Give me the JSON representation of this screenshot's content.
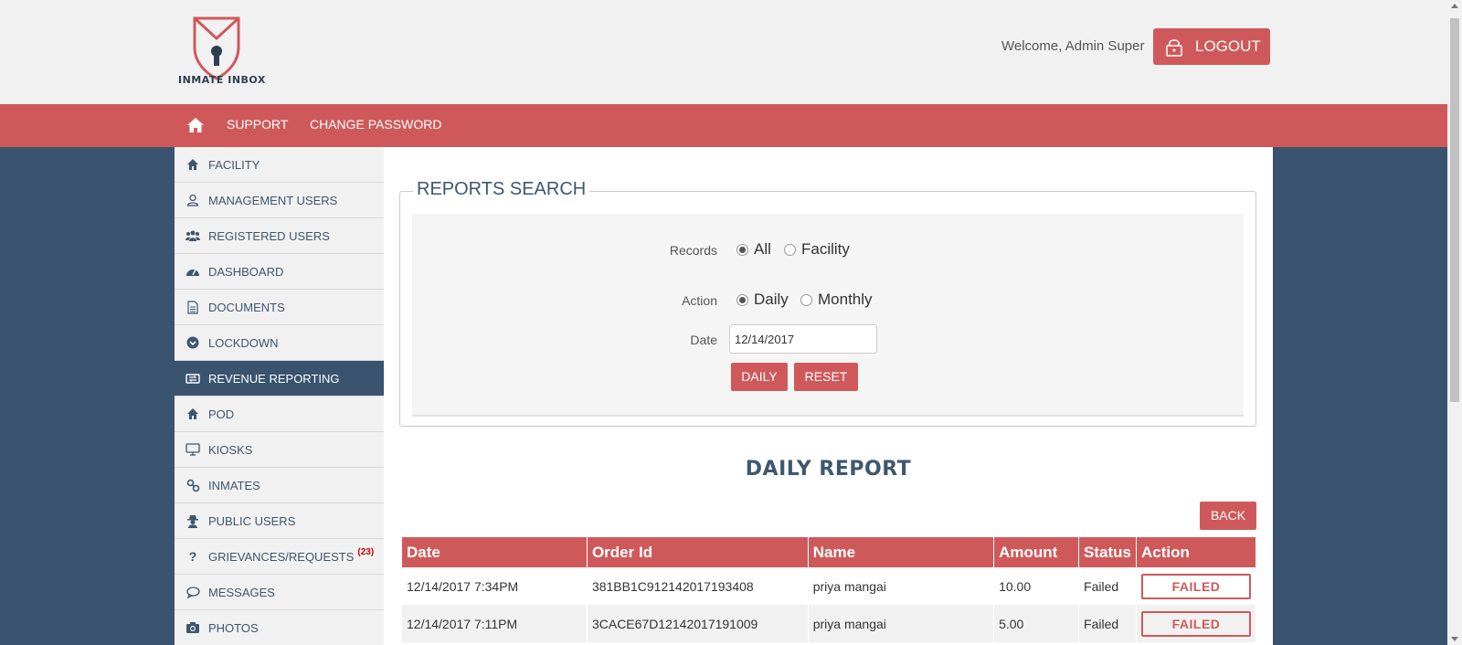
{
  "header": {
    "logo_text": "INMATE INBOX",
    "welcome": "Welcome, Admin Super",
    "logout_label": "LOGOUT"
  },
  "nav": {
    "links": [
      "SUPPORT",
      "CHANGE PASSWORD"
    ]
  },
  "sidebar": {
    "items": [
      {
        "label": "FACILITY",
        "icon": "home-icon"
      },
      {
        "label": "MANAGEMENT USERS",
        "icon": "user-icon"
      },
      {
        "label": "REGISTERED USERS",
        "icon": "users-icon"
      },
      {
        "label": "DASHBOARD",
        "icon": "dashboard-icon"
      },
      {
        "label": "DOCUMENTS",
        "icon": "document-icon"
      },
      {
        "label": "LOCKDOWN",
        "icon": "chevron-circle-icon"
      },
      {
        "label": "REVENUE REPORTING",
        "icon": "exchange-icon",
        "active": true
      },
      {
        "label": "POD",
        "icon": "home-icon"
      },
      {
        "label": "KIOSKS",
        "icon": "monitor-icon"
      },
      {
        "label": "INMATES",
        "icon": "link-icon"
      },
      {
        "label": "PUBLIC USERS",
        "icon": "user-secret-icon"
      },
      {
        "label": "GRIEVANCES/REQUESTS",
        "icon": "question-icon",
        "badge": "(23)"
      },
      {
        "label": "MESSAGES",
        "icon": "chat-icon"
      },
      {
        "label": "PHOTOS",
        "icon": "camera-icon"
      }
    ]
  },
  "search": {
    "legend": "REPORTS SEARCH",
    "records_label": "Records",
    "records_options": [
      "All",
      "Facility"
    ],
    "records_selected": "All",
    "action_label": "Action",
    "action_options": [
      "Daily",
      "Monthly"
    ],
    "action_selected": "Daily",
    "date_label": "Date",
    "date_value": "12/14/2017",
    "daily_button": "DAILY",
    "reset_button": "RESET"
  },
  "report": {
    "title": "DAILY REPORT",
    "back_button": "BACK",
    "columns": [
      "Date",
      "Order Id",
      "Name",
      "Amount",
      "Status",
      "Action"
    ],
    "rows": [
      {
        "date": "12/14/2017 7:34PM",
        "order_id": "381BB1C912142017193408",
        "name": "priya mangai",
        "amount": "10.00",
        "status": "Failed",
        "action": "FAILED"
      },
      {
        "date": "12/14/2017 7:11PM",
        "order_id": "3CACE67D12142017191009",
        "name": "priya mangai",
        "amount": "5.00",
        "status": "Failed",
        "action": "FAILED"
      }
    ]
  },
  "colors": {
    "brand_red": "#cf595a",
    "navy": "#3a536e"
  }
}
